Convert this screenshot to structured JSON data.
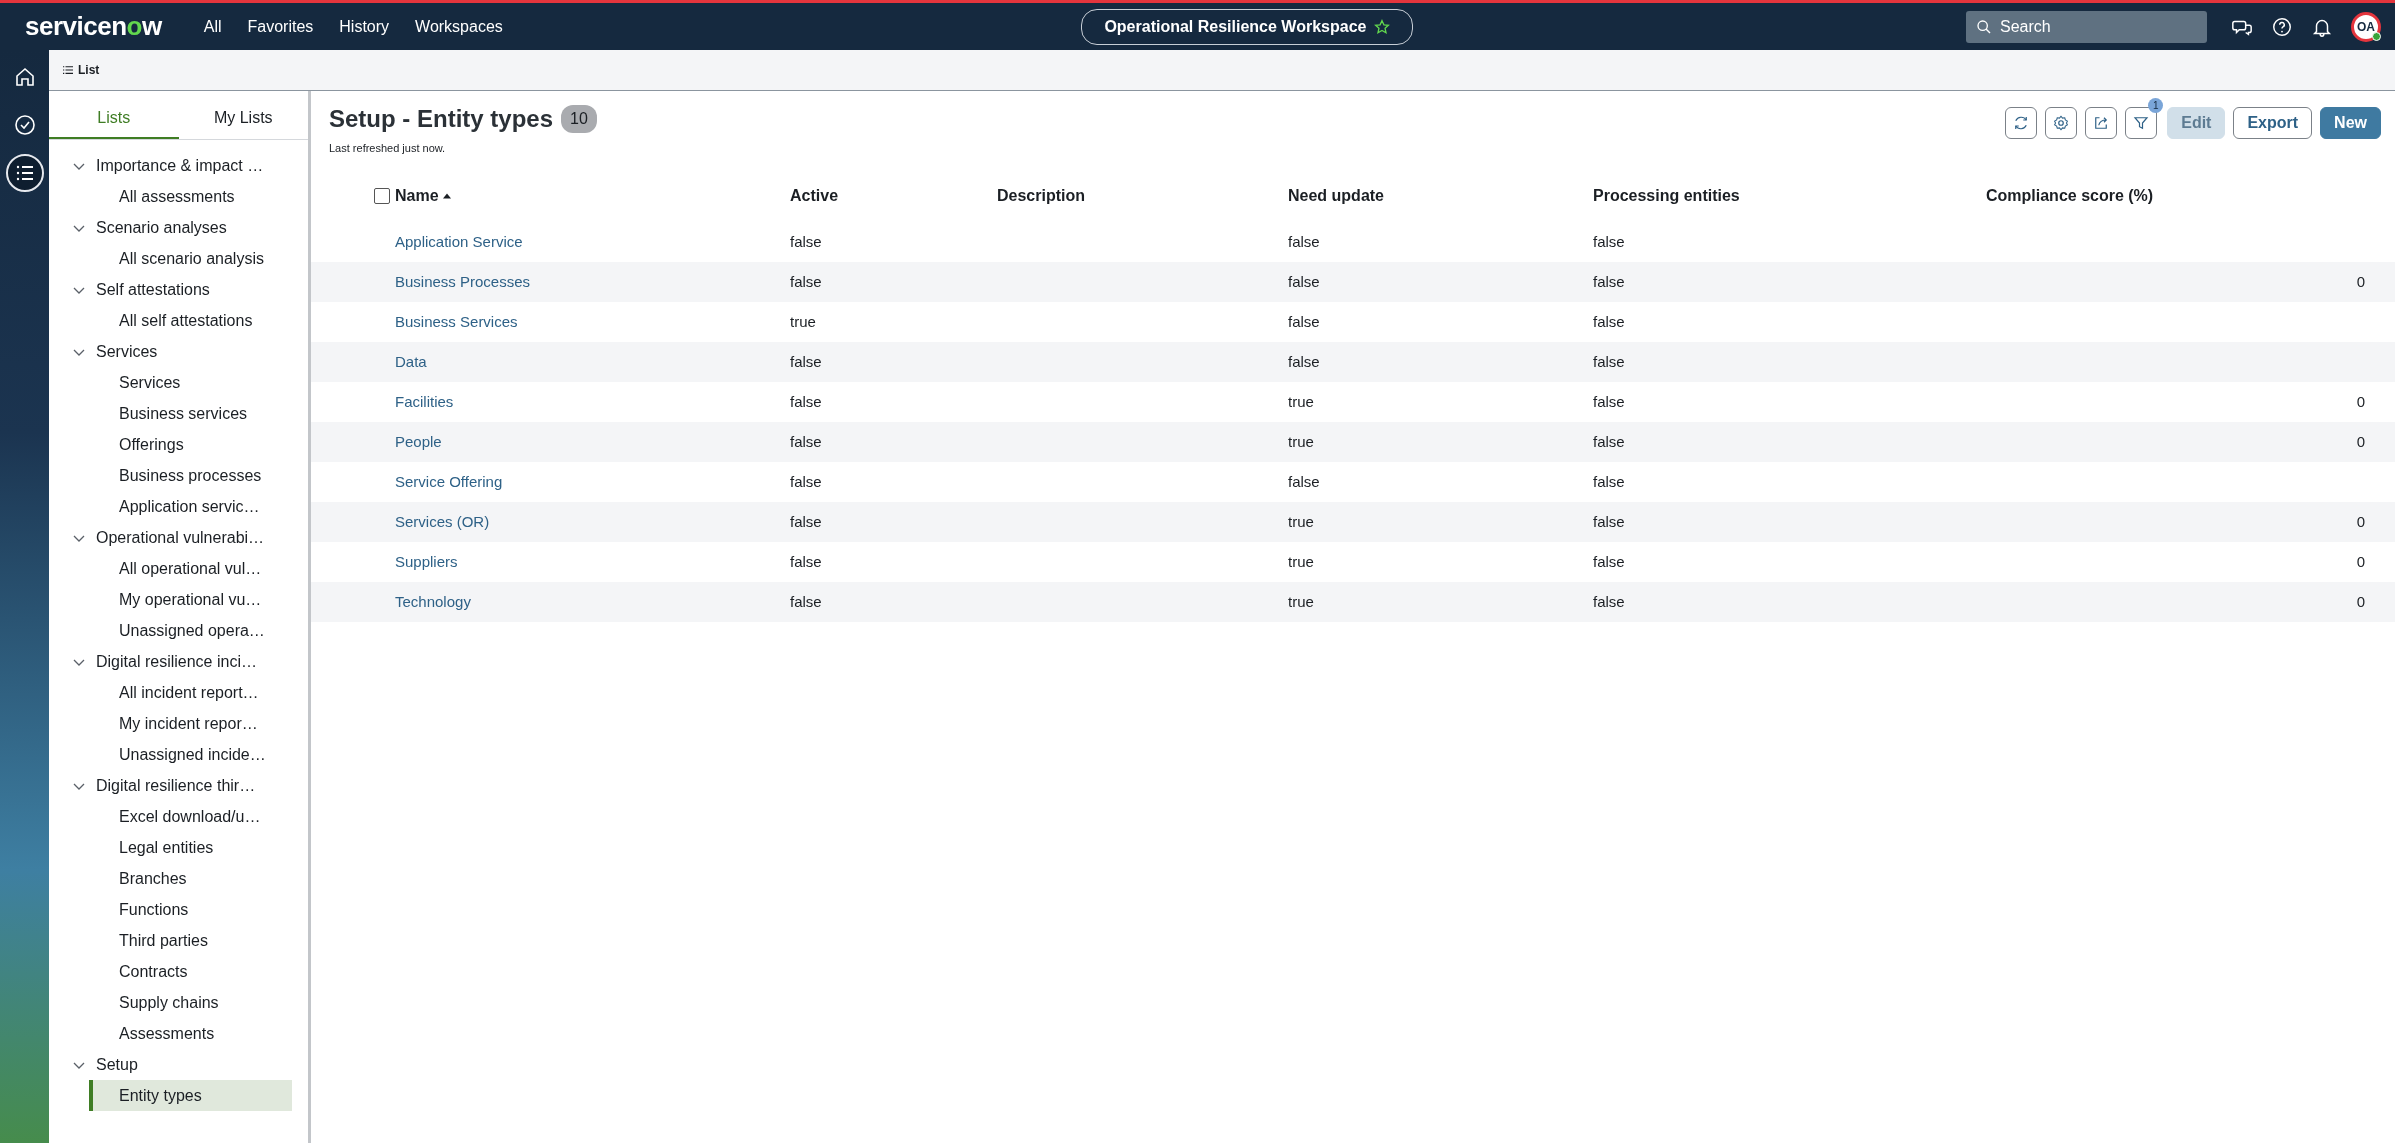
{
  "topbar": {
    "logo": "servicenow",
    "menus": [
      {
        "label": "All"
      },
      {
        "label": "Favorites"
      },
      {
        "label": "History"
      },
      {
        "label": "Workspaces"
      }
    ],
    "workspace": {
      "label": "Operational Resilience Workspace",
      "starred": false
    },
    "search": {
      "placeholder": "Search"
    },
    "avatar": {
      "initials": "OA"
    }
  },
  "rail": [
    {
      "selected": false
    },
    {
      "selected": false
    },
    {
      "selected": true
    }
  ],
  "subheader": {
    "title": "List"
  },
  "sidebar": {
    "tabs": [
      {
        "label": "Lists",
        "selected": true
      },
      {
        "label": "My Lists",
        "selected": false
      }
    ],
    "groups": [
      {
        "label": "Importance & impact …",
        "expanded": true,
        "children": [
          {
            "label": "All assessments",
            "selected": false
          }
        ]
      },
      {
        "label": "Scenario analyses",
        "expanded": true,
        "children": [
          {
            "label": "All scenario analysis",
            "selected": false
          }
        ]
      },
      {
        "label": "Self attestations",
        "expanded": true,
        "children": [
          {
            "label": "All self attestations",
            "selected": false
          }
        ]
      },
      {
        "label": "Services",
        "expanded": true,
        "children": [
          {
            "label": "Services",
            "selected": false
          },
          {
            "label": "Business services",
            "selected": false
          },
          {
            "label": "Offerings",
            "selected": false
          },
          {
            "label": "Business processes",
            "selected": false
          },
          {
            "label": "Application servic…",
            "selected": false
          }
        ]
      },
      {
        "label": "Operational vulnerabi…",
        "expanded": true,
        "children": [
          {
            "label": "All operational vul…",
            "selected": false
          },
          {
            "label": "My operational vu…",
            "selected": false
          },
          {
            "label": "Unassigned opera…",
            "selected": false
          }
        ]
      },
      {
        "label": "Digital resilience inci…",
        "expanded": true,
        "children": [
          {
            "label": "All incident report…",
            "selected": false
          },
          {
            "label": "My incident repor…",
            "selected": false
          },
          {
            "label": "Unassigned incide…",
            "selected": false
          }
        ]
      },
      {
        "label": "Digital resilience thir…",
        "expanded": true,
        "children": [
          {
            "label": "Excel download/u…",
            "selected": false
          },
          {
            "label": "Legal entities",
            "selected": false
          },
          {
            "label": "Branches",
            "selected": false
          },
          {
            "label": "Functions",
            "selected": false
          },
          {
            "label": "Third parties",
            "selected": false
          },
          {
            "label": "Contracts",
            "selected": false
          },
          {
            "label": "Supply chains",
            "selected": false
          },
          {
            "label": "Assessments",
            "selected": false
          }
        ]
      },
      {
        "label": "Setup",
        "expanded": true,
        "children": [
          {
            "label": "Entity types",
            "selected": true
          }
        ]
      }
    ]
  },
  "main": {
    "title": "Setup - Entity types",
    "count": "10",
    "refreshed": "Last refreshed just now.",
    "toolbar": {
      "filter_badge": "1",
      "buttons": [
        {
          "label": "Edit",
          "kind": "secondary",
          "disabled": true
        },
        {
          "label": "Export",
          "kind": "secondary",
          "disabled": false
        },
        {
          "label": "New",
          "kind": "primary",
          "disabled": false
        }
      ]
    },
    "table": {
      "select_all": {
        "checked": false
      },
      "columns": [
        {
          "label": "Name",
          "sorted": true,
          "ascending": true
        },
        {
          "label": "Active"
        },
        {
          "label": "Description"
        },
        {
          "label": "Need update"
        },
        {
          "label": "Processing entities"
        },
        {
          "label": "Compliance score (%)"
        }
      ],
      "rows": [
        {
          "cells": [
            "Application Service",
            "false",
            null,
            "false",
            "false",
            null
          ]
        },
        {
          "cells": [
            "Business Processes",
            "false",
            null,
            "false",
            "false",
            "0"
          ]
        },
        {
          "cells": [
            "Business Services",
            "true",
            null,
            "false",
            "false",
            null
          ]
        },
        {
          "cells": [
            "Data",
            "false",
            null,
            "false",
            "false",
            null
          ]
        },
        {
          "cells": [
            "Facilities",
            "false",
            null,
            "true",
            "false",
            "0"
          ]
        },
        {
          "cells": [
            "People",
            "false",
            null,
            "true",
            "false",
            "0"
          ]
        },
        {
          "cells": [
            "Service Offering",
            "false",
            null,
            "false",
            "false",
            null
          ]
        },
        {
          "cells": [
            "Services (OR)",
            "false",
            null,
            "true",
            "false",
            "0"
          ]
        },
        {
          "cells": [
            "Suppliers",
            "false",
            null,
            "true",
            "false",
            "0"
          ]
        },
        {
          "cells": [
            "Technology",
            "false",
            null,
            "true",
            "false",
            "0"
          ]
        }
      ]
    }
  }
}
